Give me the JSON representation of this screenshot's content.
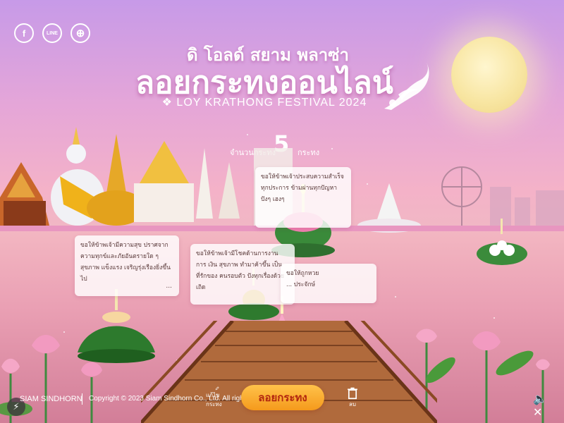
{
  "social": {
    "facebook_glyph": "f",
    "line_glyph": "LINE",
    "web_glyph": "⊕"
  },
  "header": {
    "title_top": "ดิ โอลด์ สยาม พลาซ่า",
    "title_main": "ลอยกระทงออนไลน์",
    "subtitle": "❖ LOY KRATHONG FESTIVAL 2024"
  },
  "counter": {
    "prefix": "จำนวนกระทง",
    "value": "5",
    "suffix": "กระทง"
  },
  "messages": [
    {
      "text": "ขอให้ข้าพเจ้าประสบความสำเร็จ ทุกประการ ข้ามผ่านทุกปัญหา ปังๆ เฮงๆ",
      "more": ""
    },
    {
      "text": "ขอให้ข้าพเจ้ามีความสุข ปราศจาก ความทุกข์และภัยอันตรายใด ๆ สุขภาพ แข็งแรง เจริญรุ่งเรืองยิ่งขึ้นไป",
      "more": "..."
    },
    {
      "text": "ขอให้ข้าพเจ้ามีโชคด้านการงาน การ เงิน สุขภาพ ทำมาค้าขึ้น เป็นที่รักของ คนรอบตัว ปังทุกเรื่องด้วยเถิด",
      "more": ""
    },
    {
      "text": "ขอให้ถูกหวย",
      "more": "... ประจักษ์"
    }
  ],
  "footer": {
    "brand": "SIAM SINDHORN",
    "copyright": "Copyright © 2023 Siam Sindhorn Co., Ltd. All rights reserved",
    "edit_label": "แก้ไขกระทง",
    "main_button": "ลอยกระทง",
    "delete_label": "ลบ",
    "sound_glyph": "🔈✕"
  },
  "colors": {
    "sky_top": "#c79ae8",
    "water": "#eaa0b4",
    "button": "#f59a1c",
    "button_text": "#b2260f",
    "moon": "#f8e6a3"
  }
}
